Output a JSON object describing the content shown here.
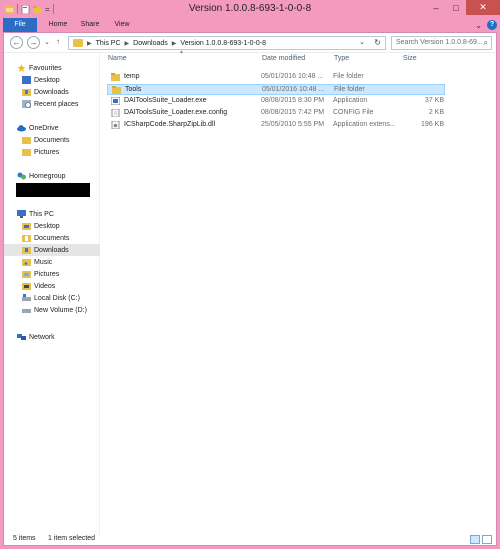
{
  "window": {
    "title": "Version 1.0.0.8-693-1-0-0-8"
  },
  "window_controls": {
    "minimize": "–",
    "maximize": "□",
    "close": "✕"
  },
  "quick_access": {
    "dropdown": "="
  },
  "ribbon": {
    "tabs": [
      "File",
      "Home",
      "Share",
      "View"
    ],
    "expand": "⌄",
    "help": "?"
  },
  "nav": {
    "back": "←",
    "forward": "→",
    "recent": "⌄",
    "up": "↑"
  },
  "address": {
    "crumbs": [
      "This PC",
      "Downloads",
      "Version 1.0.0.8-693-1-0-0-8"
    ],
    "separator": "▶",
    "dropdown": "⌄",
    "refresh": "↻"
  },
  "search": {
    "placeholder": "Search Version 1.0.0.8-69...",
    "icon": "⌕"
  },
  "columns": {
    "name": "Name",
    "date": "Date modified",
    "type": "Type",
    "size": "Size",
    "sort": "▲"
  },
  "files": [
    {
      "name": "temp",
      "date": "05/01/2016 10:48 ...",
      "type": "File folder",
      "size": "",
      "icon": "folder-icon",
      "selected": false
    },
    {
      "name": "Tools",
      "date": "05/01/2016 10:48 ...",
      "type": "File folder",
      "size": "",
      "icon": "folder-icon",
      "selected": true
    },
    {
      "name": "DAIToolsSuite_Loader.exe",
      "date": "08/08/2015 8:30 PM",
      "type": "Application",
      "size": "37 KB",
      "icon": "exe-icon",
      "selected": false
    },
    {
      "name": "DAIToolsSuite_Loader.exe.config",
      "date": "08/08/2015 7:42 PM",
      "type": "CONFIG File",
      "size": "2 KB",
      "icon": "config-file-icon",
      "selected": false
    },
    {
      "name": "ICSharpCode.SharpZipLib.dll",
      "date": "25/05/2010 5:55 PM",
      "type": "Application extens...",
      "size": "196 KB",
      "icon": "dll-icon",
      "selected": false
    }
  ],
  "sidebar": {
    "favourites": {
      "label": "Favourites",
      "items": [
        "Desktop",
        "Downloads",
        "Recent places"
      ]
    },
    "onedrive": {
      "label": "OneDrive",
      "items": [
        "Documents",
        "Pictures"
      ]
    },
    "homegroup": {
      "label": "Homegroup"
    },
    "thispc": {
      "label": "This PC",
      "items": [
        "Desktop",
        "Documents",
        "Downloads",
        "Music",
        "Pictures",
        "Videos",
        "Local Disk (C:)",
        "New Volume (D:)"
      ]
    },
    "network": {
      "label": "Network"
    }
  },
  "status": {
    "items": "5 items",
    "selected": "1 item selected"
  },
  "colors": {
    "accent": "#f49ac1",
    "file_tab": "#2b6cc4",
    "close": "#c7524f",
    "selection": "#cce8ff",
    "folder": "#e7c14c"
  }
}
